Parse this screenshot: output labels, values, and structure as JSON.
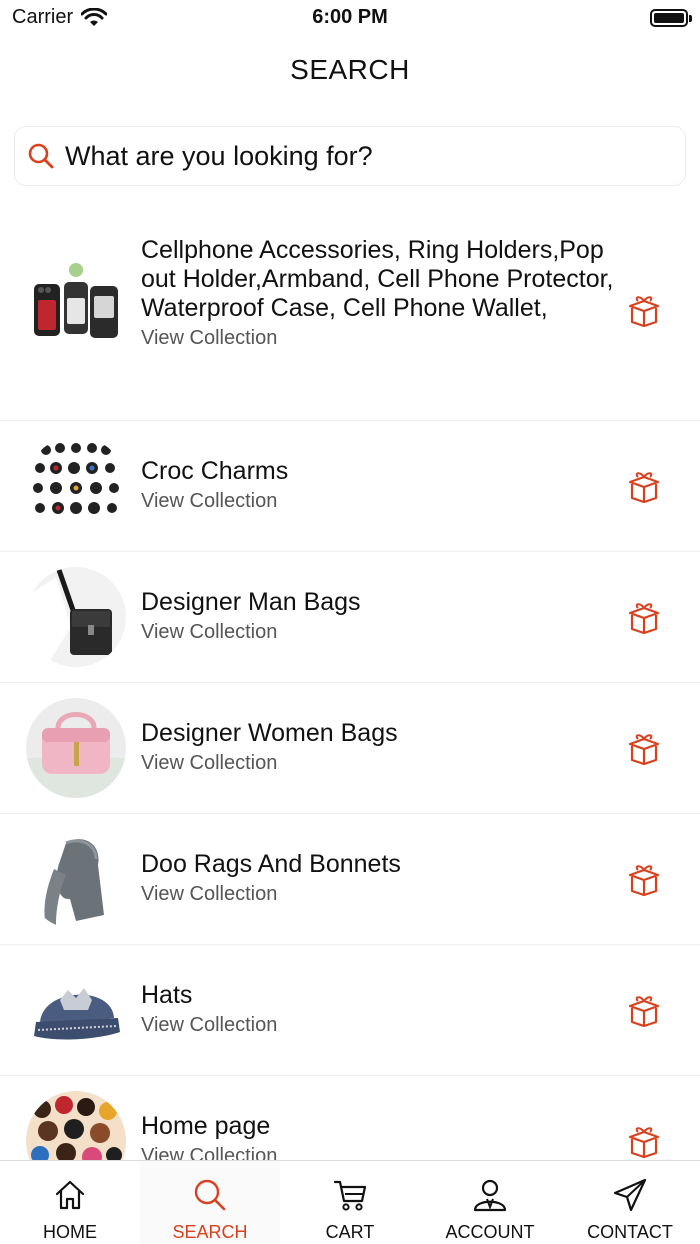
{
  "status": {
    "carrier": "Carrier",
    "time": "6:00 PM"
  },
  "header": {
    "title": "SEARCH"
  },
  "search": {
    "placeholder": "What are you looking for?"
  },
  "accent_color": "#d9411e",
  "collections": [
    {
      "title": "Cellphone Accessories, Ring Holders,Pop out Holder,Armband, Cell Phone Protector, Waterproof Case, Cell Phone Wallet,",
      "link": "View Collection",
      "thumb": "cellphone-cases-image"
    },
    {
      "title": "Croc Charms",
      "link": "View Collection",
      "thumb": "croc-charms-image"
    },
    {
      "title": "Designer Man Bags",
      "link": "View Collection",
      "thumb": "man-bag-image"
    },
    {
      "title": "Designer Women Bags",
      "link": "View Collection",
      "thumb": "pink-handbag-image"
    },
    {
      "title": "Doo Rags And Bonnets",
      "link": "View Collection",
      "thumb": "durag-image"
    },
    {
      "title": "Hats",
      "link": "View Collection",
      "thumb": "denim-cap-image"
    },
    {
      "title": "Home page",
      "link": "View Collection",
      "thumb": "stickers-image"
    }
  ],
  "tabs": [
    {
      "label": "HOME",
      "icon": "home-icon",
      "active": false
    },
    {
      "label": "SEARCH",
      "icon": "search-icon",
      "active": true
    },
    {
      "label": "CART",
      "icon": "cart-icon",
      "active": false
    },
    {
      "label": "ACCOUNT",
      "icon": "account-icon",
      "active": false
    },
    {
      "label": "CONTACT",
      "icon": "send-icon",
      "active": false
    }
  ]
}
